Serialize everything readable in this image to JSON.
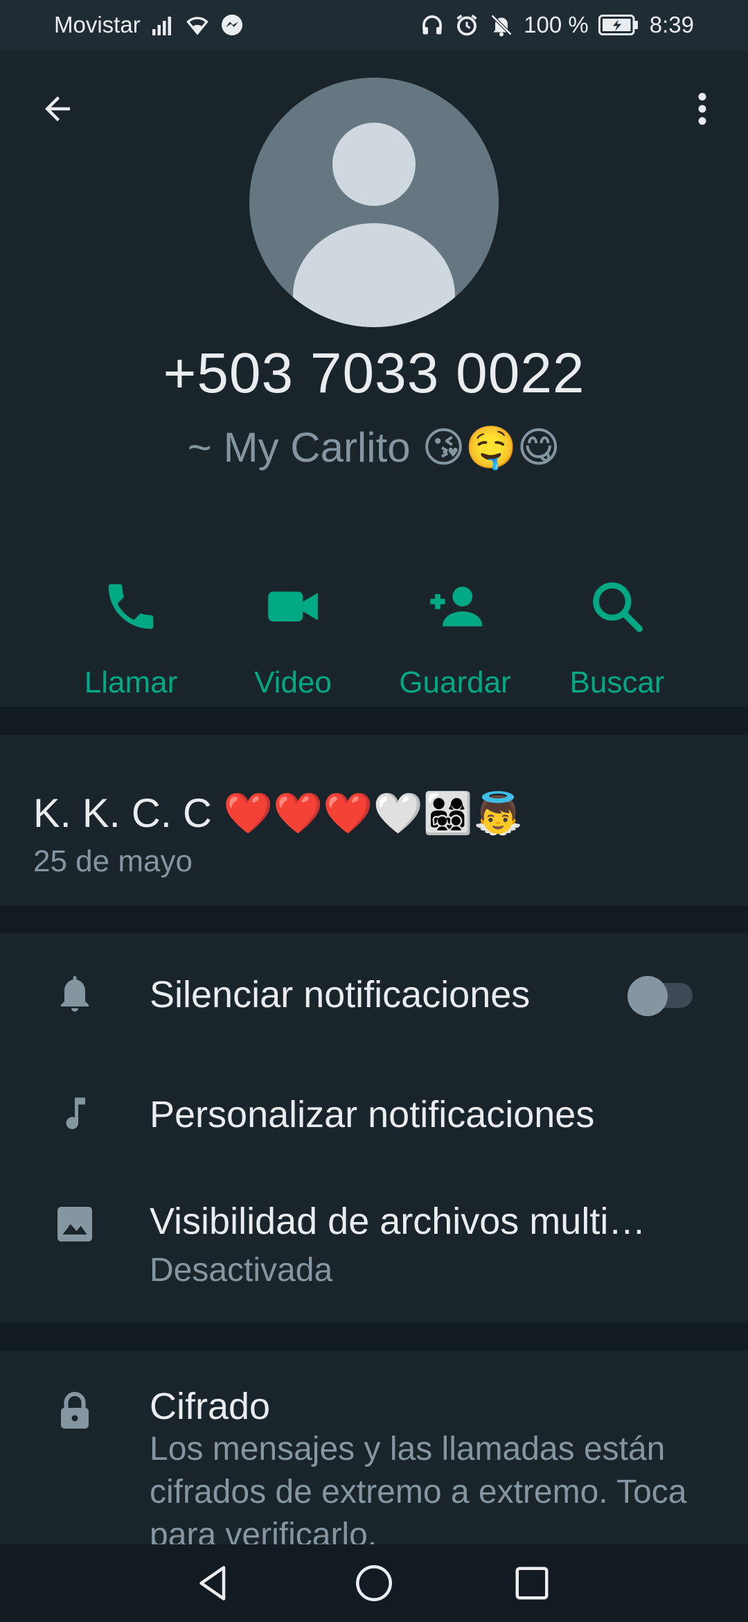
{
  "status_bar": {
    "carrier": "Movistar",
    "battery": "100 %",
    "time": "8:39"
  },
  "contact": {
    "number": "+503 7033 0022",
    "pushname": "~ My Carlito 😘🤤😋"
  },
  "actions": [
    {
      "label": "Llamar",
      "icon": "phone-icon"
    },
    {
      "label": "Video",
      "icon": "video-icon"
    },
    {
      "label": "Guardar",
      "icon": "add-contact-icon"
    },
    {
      "label": "Buscar",
      "icon": "search-icon"
    }
  ],
  "about": {
    "text": "K. K. C. C ❤️❤️❤️🤍👨‍👩‍👧‍👦👼",
    "date": "25 de mayo"
  },
  "settings": {
    "mute_label": "Silenciar notificaciones",
    "mute_on": false,
    "custom_label": "Personalizar notificaciones",
    "media_label": "Visibilidad de archivos multi…",
    "media_sub": "Desactivada"
  },
  "encryption": {
    "title": "Cifrado",
    "description": "Los mensajes y las llamadas están cifrados de extremo a extremo. Toca para verificarlo."
  },
  "colors": {
    "accent": "#00a884",
    "background": "#121b22",
    "panel": "#1a242b",
    "secondary_text": "#8696a0"
  }
}
